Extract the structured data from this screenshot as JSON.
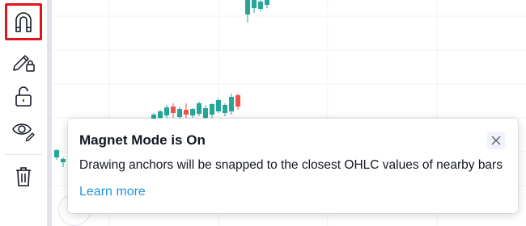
{
  "toolbar": {
    "items": [
      {
        "name": "magnet-icon",
        "active": true
      },
      {
        "name": "lock-drawing-icon",
        "active": false
      },
      {
        "name": "unlock-icon",
        "active": false
      },
      {
        "name": "eye-icon",
        "active": false
      },
      {
        "name": "trash-icon",
        "active": false
      }
    ]
  },
  "popup": {
    "title": "Magnet Mode is On",
    "description": "Drawing anchors will be snapped to the closest OHLC values of nearby bars",
    "link_label": "Learn more",
    "close_icon": "close-icon"
  },
  "colors": {
    "up_candle": "#26a69a",
    "down_candle": "#ef5350",
    "active_outline": "#e0151b",
    "link": "#2196d8"
  }
}
